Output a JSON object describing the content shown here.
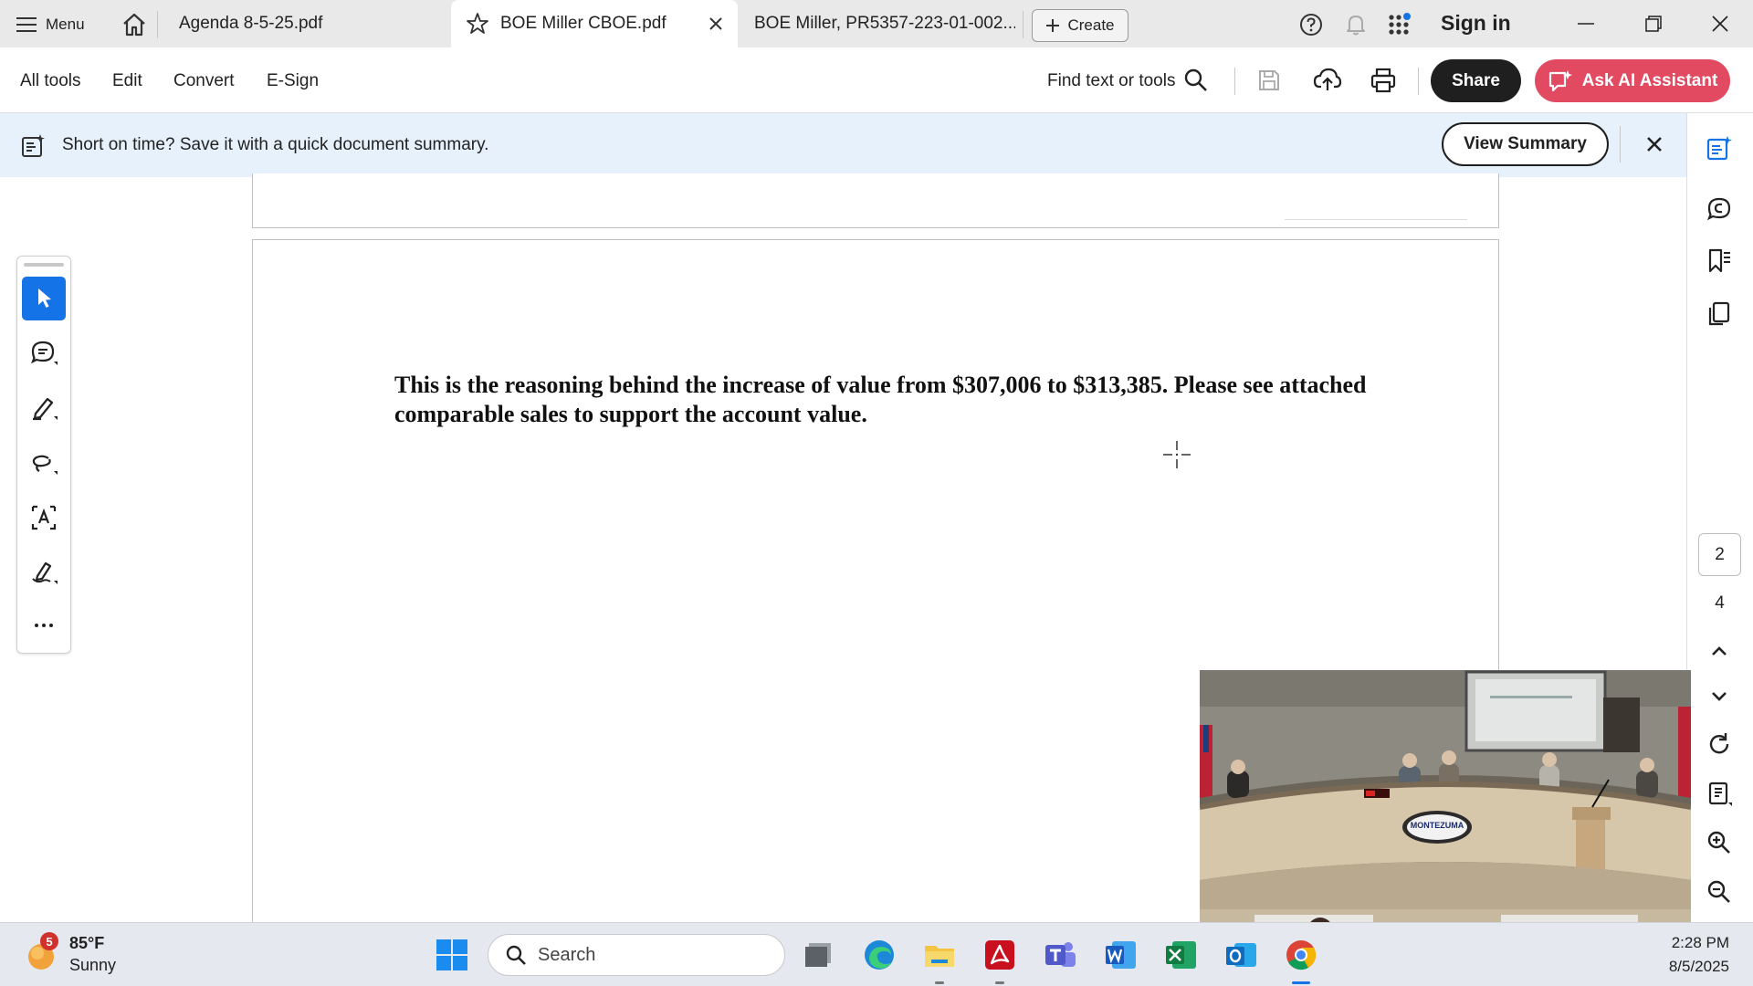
{
  "tabbar": {
    "menu_label": "Menu",
    "tabs": [
      {
        "label": "Agenda 8-5-25.pdf"
      },
      {
        "label": "BOE Miller CBOE.pdf"
      },
      {
        "label": "BOE Miller, PR5357-223-01-002..."
      }
    ],
    "create_label": "Create",
    "sign_in_label": "Sign in"
  },
  "toolbar": {
    "menus": [
      "All tools",
      "Edit",
      "Convert",
      "E-Sign"
    ],
    "find_label": "Find text or tools",
    "share_label": "Share",
    "ai_label": "Ask AI Assistant"
  },
  "banner": {
    "text": "Short on time? Save it with a quick document summary.",
    "button_label": "View Summary"
  },
  "document": {
    "body_text": "This is the reasoning behind the increase of value from $307,006 to $313,385.  Please see attached comparable sales to support the account value."
  },
  "navigation": {
    "current_page": "2",
    "total_pages": "4"
  },
  "video": {
    "seal_text": "MONTEZUMA"
  },
  "taskbar": {
    "weather_badge": "5",
    "temperature": "85°F",
    "condition": "Sunny",
    "search_placeholder": "Search",
    "time": "2:28 PM",
    "date": "8/5/2025"
  },
  "colors": {
    "accent": "#1473e6",
    "ai_button": "#e24a62",
    "banner_bg": "#e6f1fb",
    "share_button": "#1f1f1f"
  }
}
